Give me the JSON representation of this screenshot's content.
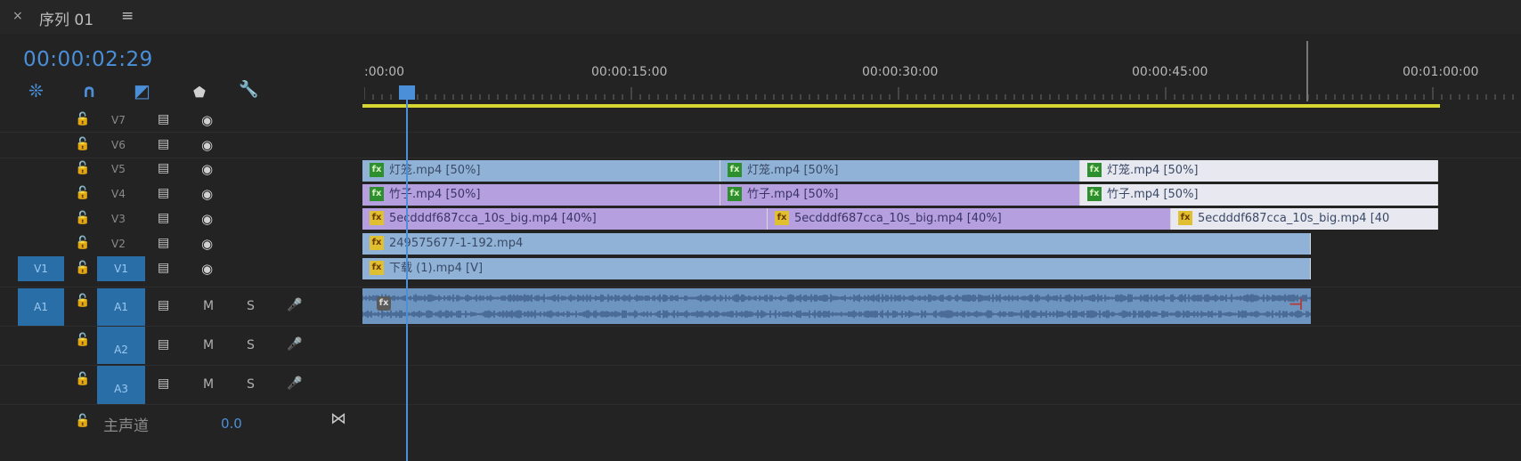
{
  "header": {
    "close": "×",
    "sequence_title": "序列 01",
    "menu": "≡",
    "timecode": "00:00:02:29"
  },
  "tools": [
    {
      "name": "nest-tool-icon",
      "glyph": "❊"
    },
    {
      "name": "snap-magnet-icon",
      "glyph": "∩"
    },
    {
      "name": "linked-selection-icon",
      "glyph": "◩"
    },
    {
      "name": "add-marker-icon",
      "glyph": "⬟"
    },
    {
      "name": "wrench-settings-icon",
      "glyph": "🔧"
    }
  ],
  "ruler": {
    "labels": [
      ":00:00",
      "00:00:15:00",
      "00:00:30:00",
      "00:00:45:00",
      "00:01:00:00"
    ]
  },
  "video_tracks": [
    {
      "label": "V7",
      "source": "",
      "lock": "🔓",
      "film": "▤",
      "eye": "◉"
    },
    {
      "label": "V6",
      "source": "",
      "lock": "🔓",
      "film": "▤",
      "eye": "◉"
    },
    {
      "label": "V5",
      "source": "",
      "lock": "🔓",
      "film": "▤",
      "eye": "◉"
    },
    {
      "label": "V4",
      "source": "",
      "lock": "🔓",
      "film": "▤",
      "eye": "◉"
    },
    {
      "label": "V3",
      "source": "",
      "lock": "🔓",
      "film": "▤",
      "eye": "◉"
    },
    {
      "label": "V2",
      "source": "",
      "lock": "🔓",
      "film": "▤",
      "eye": "◉"
    },
    {
      "label": "V1",
      "source": "V1",
      "lock": "🔓",
      "film": "▤",
      "eye": "◉"
    }
  ],
  "audio_tracks": [
    {
      "label": "A1",
      "source": "A1",
      "lock": "🔓",
      "film": "▤",
      "m": "M",
      "s": "S",
      "mic": "🎤"
    },
    {
      "label": "A2",
      "source": "",
      "lock": "🔓",
      "film": "▤",
      "m": "M",
      "s": "S",
      "mic": "🎤"
    },
    {
      "label": "A3",
      "source": "",
      "lock": "🔓",
      "film": "▤",
      "m": "M",
      "s": "S",
      "mic": "🎤"
    }
  ],
  "master": {
    "lock": "🔓",
    "label": "主声道",
    "value": "0.0",
    "end_icon": "⋈"
  },
  "clips": {
    "v5": [
      "灯笼.mp4 [50%]",
      "灯笼.mp4 [50%]",
      "灯笼.mp4 [50%]"
    ],
    "v4": [
      "竹子.mp4 [50%]",
      "竹子.mp4 [50%]",
      "竹子.mp4 [50%]"
    ],
    "v3": [
      "5ecdddf687cca_10s_big.mp4 [40%]",
      "5ecdddf687cca_10s_big.mp4 [40%]",
      "5ecdddf687cca_10s_big.mp4 [40"
    ],
    "v2": "249575677-1-192.mp4",
    "v1": "下载 (1).mp4 [V]",
    "fx": "fx"
  },
  "colors": {
    "accent": "#4a8fd8",
    "workarea": "#d8d530",
    "clip_blue": "#8fb2d6",
    "clip_purple": "#b59fde",
    "audio": "#6e94c0"
  }
}
